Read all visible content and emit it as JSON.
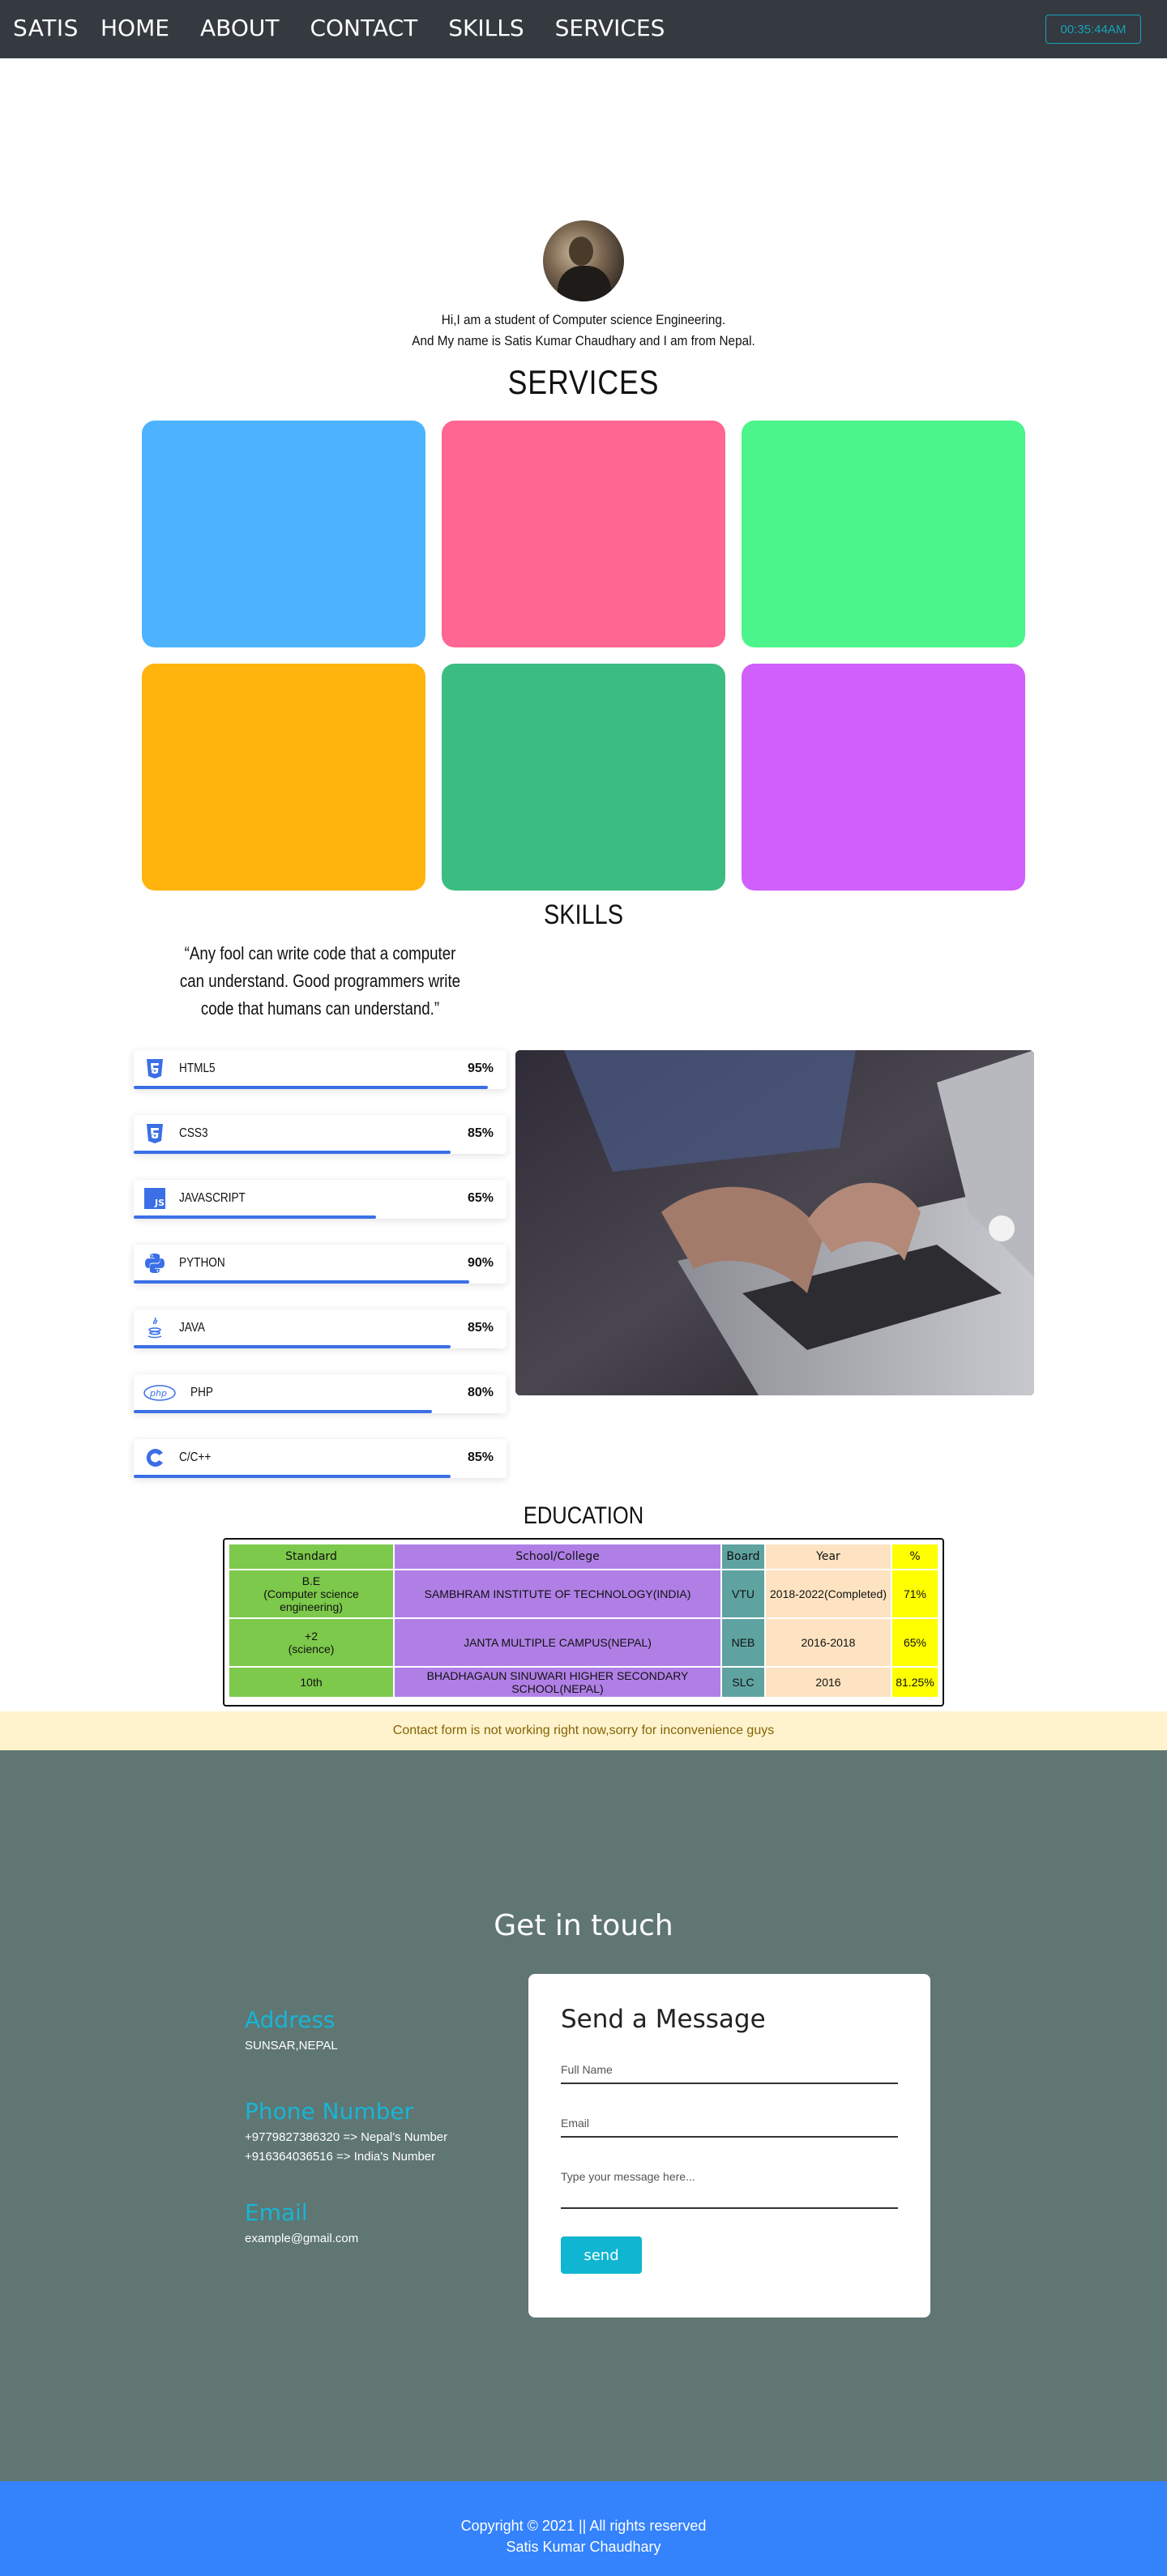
{
  "nav": {
    "brand": "SATIS",
    "links": [
      "HOME",
      "ABOUT",
      "CONTACT",
      "SKILLS",
      "SERVICES"
    ],
    "clock": "00:35:44AM"
  },
  "intro": {
    "line1": "Hi,I am a student of Computer science Engineering.",
    "line2": "And My name is Satis Kumar Chaudhary and I am from Nepal."
  },
  "services": {
    "heading": "SERVICES",
    "card_colors": [
      "#4db3ff",
      "#ff6692",
      "#4bf58b",
      "#ffb30d",
      "#3bbd82",
      "#d05ffb"
    ]
  },
  "skills": {
    "heading": "SKILLS",
    "quote": "“Any fool can write code that a computer can understand. Good programmers write code that humans can understand.”",
    "items": [
      {
        "name": "HTML5",
        "percent": "95%",
        "icon": "html5-icon"
      },
      {
        "name": "CSS3",
        "percent": "85%",
        "icon": "css3-icon"
      },
      {
        "name": "JAVASCRIPT",
        "percent": "65%",
        "icon": "js-icon"
      },
      {
        "name": "PYTHON",
        "percent": "90%",
        "icon": "python-icon"
      },
      {
        "name": "JAVA",
        "percent": "85%",
        "icon": "java-icon"
      },
      {
        "name": "PHP",
        "percent": "80%",
        "icon": "php-icon"
      },
      {
        "name": "C/C++",
        "percent": "85%",
        "icon": "c-icon"
      }
    ]
  },
  "education": {
    "heading": "EDUCATION",
    "headers": [
      "Standard",
      "School/College",
      "Board",
      "Year",
      "%"
    ],
    "rows": [
      {
        "standard": "B.E",
        "standard_sub": "(Computer science engineering)",
        "school": "SAMBHRAM INSTITUTE OF TECHNOLOGY(INDIA)",
        "board": "VTU",
        "year": "2018-2022(Completed)",
        "pct": "71%"
      },
      {
        "standard": "+2",
        "standard_sub": "(science)",
        "school": "JANTA MULTIPLE CAMPUS(NEPAL)",
        "board": "NEB",
        "year": "2016-2018",
        "pct": "65%"
      },
      {
        "standard": "10th",
        "standard_sub": "",
        "school": "BHADHAGAUN SINUWARI HIGHER SECONDARY SCHOOL(NEPAL)",
        "board": "SLC",
        "year": "2016",
        "pct": "81.25%"
      }
    ]
  },
  "notice": "Contact form is not working right now,sorry for inconvenience guys",
  "contact": {
    "title": "Get in touch",
    "address_label": "Address",
    "address": "SUNSAR,NEPAL",
    "phone_label": "Phone Number",
    "phone1": "+9779827386320 => Nepal's Number",
    "phone2": "+916364036516 => India's Number",
    "email_label": "Email",
    "email": "example@gmail.com",
    "form_title": "Send a Message",
    "name_placeholder": "Full Name",
    "email_placeholder": "Email",
    "message_placeholder": "Type your message here...",
    "send_label": "send"
  },
  "footer": {
    "line1": "Copyright © 2021 || All rights reserved",
    "line2": "Satis Kumar Chaudhary"
  },
  "colors": {
    "nav_bg": "#343a40",
    "accent": "#17a2b8",
    "contact_bg": "#5f7672",
    "footer_bg": "#3482fc",
    "skill_bar": "#3b6fe6"
  }
}
